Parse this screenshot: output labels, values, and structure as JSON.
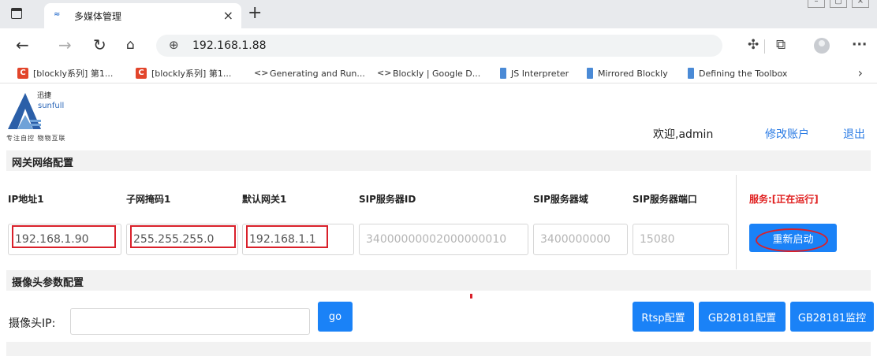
{
  "browser": {
    "tab_title": "多媒体管理",
    "url": "192.168.1.88",
    "bookmarks": [
      "[blockly系列] 第1...",
      "[blockly系列] 第1...",
      "Generating and Run...",
      "Blockly | Google D...",
      "JS Interpreter",
      "Mirrored Blockly",
      "Defining the Toolbox"
    ]
  },
  "logo": {
    "cn": "迅捷",
    "en": "sunfull",
    "tagline": "专注自控 物物互联"
  },
  "header": {
    "welcome": "欢迎,admin",
    "account_link": "修改账户",
    "logout_link": "退出"
  },
  "gateway": {
    "title": "网关网络配置",
    "columns": [
      "IP地址1",
      "子网掩码1",
      "默认网关1",
      "SIP服务器ID",
      "SIP服务器域",
      "SIP服务器端口"
    ],
    "values": {
      "ip": "192.168.1.90",
      "mask": "255.255.255.0",
      "gateway": "192.168.1.1",
      "sip_id": "34000000002000000010",
      "sip_domain": "3400000000",
      "sip_port": "15080"
    },
    "status": "服务:[正在运行]",
    "restart_label": "重新启动"
  },
  "camera": {
    "title": "摄像头参数配置",
    "ip_label": "摄像头IP:",
    "ip_value": "",
    "go_label": "go",
    "buttons": [
      "Rtsp配置",
      "GB28181配置",
      "GB28181监控"
    ]
  },
  "colors": {
    "primary": "#1a82f7",
    "highlight": "#d9202a",
    "section_bg": "#f2f2f2"
  }
}
